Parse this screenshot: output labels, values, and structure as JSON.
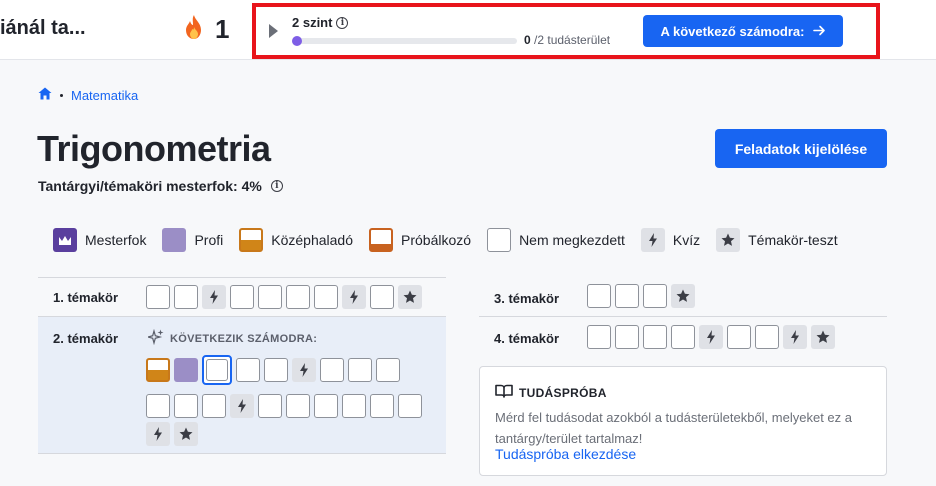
{
  "topbar": {
    "course_title": "iánál ta...",
    "streak_count": "1",
    "level": {
      "label": "2 szint",
      "progress_value": "0",
      "progress_total": " /2 tudásterület",
      "progress_fraction": 0,
      "next_button": "A következő számodra:"
    }
  },
  "breadcrumb": {
    "item": "Matematika"
  },
  "page": {
    "title": "Trigonometria",
    "assign_button": "Feladatok kijelölése",
    "mastery_text": "Tantárgyi/témaköri mesterfok: 4%"
  },
  "legend": [
    {
      "key": "mastered",
      "label": "Mesterfok"
    },
    {
      "key": "proficient",
      "label": "Profi"
    },
    {
      "key": "familiar",
      "label": "Középhaladó"
    },
    {
      "key": "attempted",
      "label": "Próbálkozó"
    },
    {
      "key": "notstarted",
      "label": "Nem megkezdett"
    },
    {
      "key": "quiz",
      "label": "Kvíz"
    },
    {
      "key": "test",
      "label": "Témakör-teszt"
    }
  ],
  "units": {
    "unit1": {
      "label": "1. témakör",
      "skills": [
        "n",
        "n",
        "q",
        "n",
        "n",
        "n",
        "n",
        "q",
        "n",
        "t"
      ]
    },
    "unit2": {
      "label": "2. témakör",
      "next_up": "KÖVETKEZIK SZÁMODRA:",
      "skills_row1": [
        "f",
        "p",
        "c",
        "n",
        "n",
        "q",
        "n",
        "n",
        "n"
      ],
      "skills_row2": [
        "n",
        "n",
        "n",
        "q",
        "n",
        "n",
        "n",
        "n",
        "n",
        "n"
      ],
      "skills_row3": [
        "q",
        "t"
      ]
    },
    "unit3": {
      "label": "3. témakör",
      "skills": [
        "n",
        "n",
        "n",
        "t"
      ]
    },
    "unit4": {
      "label": "4. témakör",
      "skills": [
        "n",
        "n",
        "n",
        "n",
        "q",
        "n",
        "n",
        "q",
        "t"
      ]
    }
  },
  "course_challenge": {
    "title": "TUDÁSPRÓBA",
    "description": "Mérd fel tudásodat azokból a tudásterületekből, melyeket ez a tantárgy/terület tartalmaz!",
    "link": "Tudáspróba elkezdése"
  },
  "colors": {
    "accent": "#1865f2",
    "mastered": "#5a3f9e",
    "proficient": "#9b8ec6",
    "familiar": "#d08518",
    "attempted": "#c8621f",
    "highlight_box": "#e8141b",
    "unit2_bg": "#e8eef8"
  }
}
